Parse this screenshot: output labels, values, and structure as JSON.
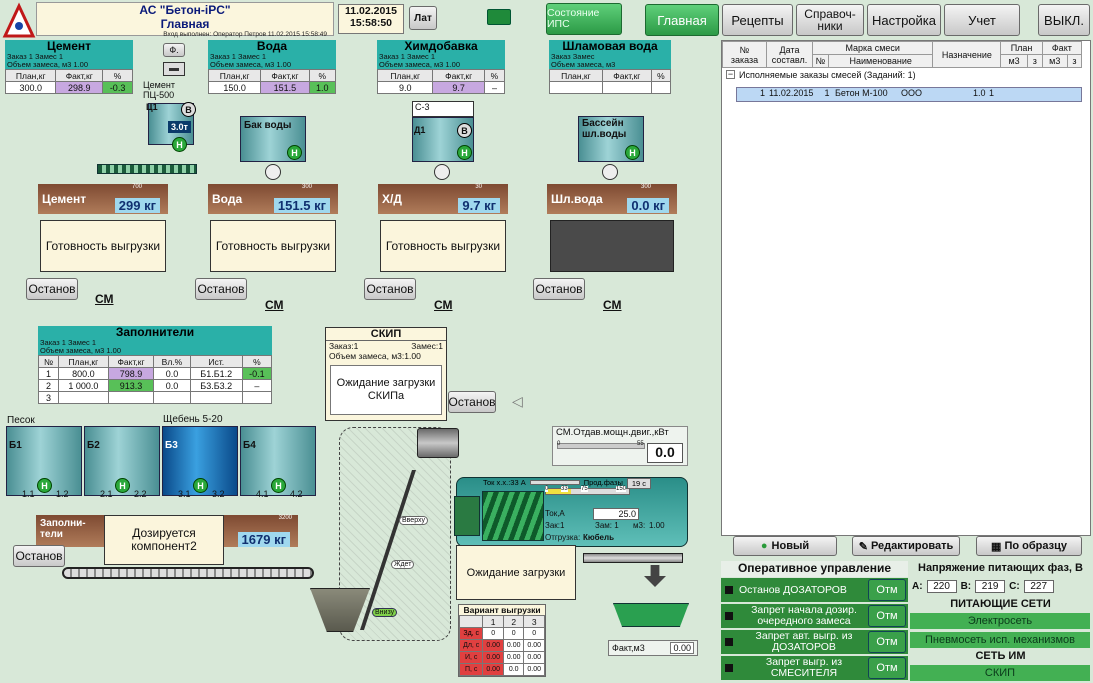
{
  "header": {
    "logo": "ELTICON",
    "app_title": "АС \"Бетон-iPC\"",
    "screen": "Главная",
    "login_line": "Вход выполнен: Оператор Петров 11.02.2015 15:58:49",
    "date": "11.02.2015",
    "time": "15:58:50",
    "lang": "Лат",
    "state_btn": "Состояние ИПС"
  },
  "nav": {
    "main": "Главная",
    "recipes": "Рецепты",
    "reference": "Справоч-ники",
    "settings": "Настройка",
    "accounting": "Учет",
    "exit": "ВЫКЛ."
  },
  "cement": {
    "title": "Цемент",
    "order": "Заказ 1   Замес 1",
    "volume": "Объем замеса, м3 1.00",
    "cols": [
      "План,кг",
      "Факт,кг",
      "%"
    ],
    "row": [
      "300.0",
      "298.9",
      "-0.3"
    ],
    "silo": "Цемент ПЦ-500",
    "silo_id": "Ц1",
    "tons": "3.0т",
    "f_btn": "Ф.",
    "scale_label": "Цемент",
    "scale_value": "299 кг",
    "scale_max": "700",
    "ready": "Готовность выгрузки",
    "stop": "Останов",
    "cm": "СМ"
  },
  "water": {
    "title": "Вода",
    "order": "Заказ 1   Замес 1",
    "volume": "Объем замеса, м3 1.00",
    "cols": [
      "План,кг",
      "Факт,кг",
      "%"
    ],
    "row": [
      "150.0",
      "151.5",
      "1.0"
    ],
    "tank": "Бак воды",
    "scale_label": "Вода",
    "scale_value": "151.5 кг",
    "scale_max": "300",
    "ready": "Готовность выгрузки",
    "stop": "Останов",
    "cm": "СМ"
  },
  "admix": {
    "title": "Химдобавка",
    "order": "Заказ 1   Замес 1",
    "volume": "Объем замеса, м3 1.00",
    "cols": [
      "План,кг",
      "Факт,кг",
      "%"
    ],
    "row": [
      "9.0",
      "9.7",
      "–"
    ],
    "tank": "С-3",
    "tank_id": "Д1",
    "scale_label": "Х/Д",
    "scale_value": "9.7 кг",
    "scale_max": "30",
    "ready": "Готовность выгрузки",
    "stop": "Останов",
    "cm": "СМ"
  },
  "slurry": {
    "title": "Шламовая вода",
    "order": "Заказ     Замес",
    "volume": "Объем замеса, м3",
    "cols": [
      "План,кг",
      "Факт,кг",
      "%"
    ],
    "tank": "Бассейн шл.воды",
    "scale_label": "Шл.вода",
    "scale_value": "0.0 кг",
    "scale_max": "300",
    "stop": "Останов",
    "cm": "СМ"
  },
  "aggregates": {
    "title": "Заполнители",
    "order": "Заказ 1   Замес 1",
    "volume": "Объем замеса, м3 1.00",
    "cols": [
      "№",
      "План,кг",
      "Факт,кг",
      "Вл.%",
      "Ист.",
      "%"
    ],
    "rows": [
      [
        "1",
        "800.0",
        "798.9",
        "0.0",
        "Б1.Б1.2",
        "-0.1"
      ],
      [
        "2",
        "1 000.0",
        "913.3",
        "0.0",
        "Б3.Б3.2",
        "–"
      ],
      [
        "3",
        "",
        "",
        "",
        "",
        ""
      ]
    ],
    "bins": [
      {
        "name": "Песок",
        "id": "Б1",
        "g1": "1.1",
        "g2": "1.2"
      },
      {
        "name": "",
        "id": "Б2",
        "g1": "2.1",
        "g2": "2.2"
      },
      {
        "name": "Щебень 5-20",
        "id": "Б3",
        "g1": "3.1",
        "g2": "3.2"
      },
      {
        "name": "",
        "id": "Б4",
        "g1": "4.1",
        "g2": "4.2"
      }
    ],
    "scale_label": "Заполни-тели",
    "scale_max": "3200",
    "scale_value": "1679 кг",
    "dosing": "Дозируется компонент2",
    "stop": "Останов"
  },
  "skip": {
    "title": "СКИП",
    "order": "Заказ:1",
    "batch": "Замес:1",
    "volume": "Объем замеса, м3:1.00",
    "status": "Ожидание загрузки СКИПа",
    "stop": "Останов",
    "top": "Вверху",
    "wait": "Ждет",
    "bottom": "Внизу"
  },
  "motor": {
    "label": "СМ.Отдав.мощн.двиг.,кВт",
    "min": "0",
    "max": "55",
    "value": "0.0"
  },
  "mixer": {
    "idle": "Ток х.х.:33 А",
    "phase": "Прод.фазы",
    "secs": "19 с",
    "ticks": [
      "0",
      "33",
      "75",
      "150"
    ],
    "current_label": "Ток,А",
    "current": "25.0",
    "order": "Зак:1",
    "batch": "Зам: 1",
    "m3_label": "м3:",
    "m3": "1.00",
    "ship": "Отгрузка:",
    "ship_val": "Кюбель",
    "status": "Ожидание загрузки",
    "fact_label": "Факт,м3",
    "fact": "0.00"
  },
  "unload": {
    "title": "Вариант выгрузки",
    "cols": [
      "",
      "1",
      "2",
      "3"
    ],
    "rows": [
      [
        "Зд, с",
        "0",
        "0",
        "0"
      ],
      [
        "Дл, с",
        "0.00",
        "0.00",
        "0.00"
      ],
      [
        "И, с",
        "0.00",
        "0.00",
        "0.00"
      ],
      [
        "П, с",
        "0.00",
        "0.0",
        "0.00"
      ]
    ]
  },
  "orders": {
    "cols": [
      "№ заказа",
      "Дата составл.",
      "№",
      "Наименование",
      "Назначение",
      "м3",
      "з",
      "м3",
      "з"
    ],
    "grp": [
      "Марка смеси",
      "План",
      "Факт"
    ],
    "group_row": "Исполняемые заказы смесей (Заданий: 1)",
    "rows": [
      [
        "1",
        "11.02.2015",
        "1",
        "Бетон М-100",
        "ООО",
        "1.0",
        "1",
        "",
        ""
      ]
    ]
  },
  "actions": {
    "new": "Новый",
    "edit": "Редактировать",
    "copy": "По образцу"
  },
  "oper": {
    "title": "Оперативное управление",
    "items": [
      "Останов ДОЗАТОРОВ",
      "Запрет начала дозир. очередного замеса",
      "Запрет авт. выгр. из ДОЗАТОРОВ",
      "Запрет выгр. из СМЕСИТЕЛЯ"
    ],
    "cancel": "Отм"
  },
  "voltage": {
    "title": "Напряжение питающих фаз, В",
    "a": "220",
    "b": "219",
    "c": "227",
    "a_l": "A:",
    "b_l": "B:",
    "c_l": "C:"
  },
  "networks": {
    "title": "ПИТАЮЩИЕ СЕТИ",
    "power": "Электросеть",
    "pneumo": "Пневмосеть исп. механизмов",
    "im_title": "СЕТЬ ИМ",
    "skip": "СКИП"
  }
}
